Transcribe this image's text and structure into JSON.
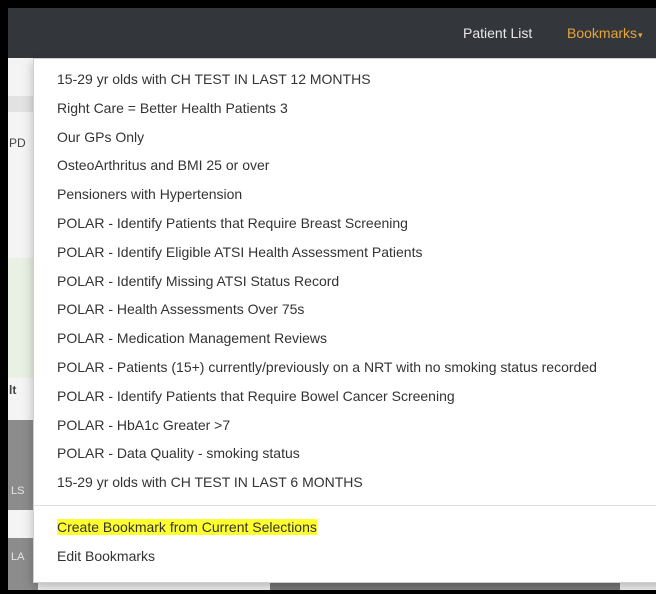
{
  "navbar": {
    "patient_list": "Patient List",
    "bookmarks": "Bookmarks",
    "bookmarks_caret": "▾"
  },
  "background": {
    "left_fragments": [
      "PD",
      "lt",
      "LS",
      "LA"
    ]
  },
  "bookmarks_menu": {
    "items": [
      "15-29 yr olds with CH TEST IN LAST 12 MONTHS",
      "Right Care = Better Health Patients 3",
      "Our GPs Only",
      "OsteoArthritus and BMI 25 or over",
      "Pensioners with Hypertension",
      "POLAR - Identify Patients that Require Breast Screening",
      "POLAR - Identify Eligible ATSI Health Assessment Patients",
      "POLAR - Identify Missing ATSI Status Record",
      "POLAR - Health Assessments Over 75s",
      "POLAR - Medication Management Reviews",
      "POLAR - Patients (15+) currently/previously on a NRT with no smoking status recorded",
      "POLAR - Identify Patients that Require Bowel Cancer Screening",
      "POLAR - HbA1c Greater >7",
      "POLAR - Data Quality - smoking status",
      "15-29 yr olds with CH TEST IN LAST 6 MONTHS"
    ],
    "create_bookmark": "Create Bookmark from Current Selections",
    "edit_bookmarks": "Edit Bookmarks",
    "highlight_color": "#ffff2e",
    "accent_color": "#e8a33a"
  }
}
